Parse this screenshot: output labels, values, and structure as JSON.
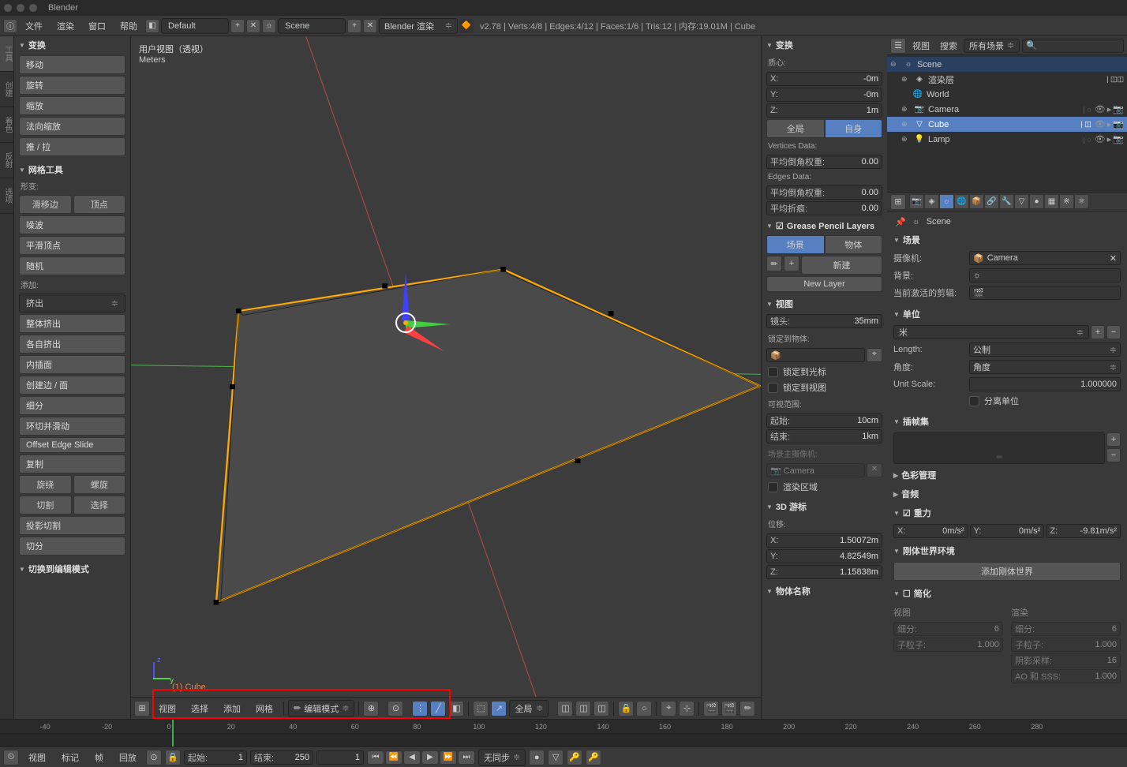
{
  "titlebar": {
    "app": "Blender"
  },
  "topbar": {
    "menus": [
      "文件",
      "渲染",
      "窗口",
      "帮助"
    ],
    "layout": "Default",
    "scene": "Scene",
    "engine": "Blender 渲染",
    "stats": "v2.78 | Verts:4/8 | Edges:4/12 | Faces:1/6 | Tris:12 | 内存:19.01M | Cube"
  },
  "left_tabs": [
    "工具",
    "创建",
    "着色",
    "反射",
    "选项"
  ],
  "tools": {
    "transform_header": "变换",
    "t_move": "移动",
    "t_rot": "旋转",
    "t_scale": "缩放",
    "t_scale_nrm": "法向缩放",
    "t_push": "推 / 拉",
    "mesh_header": "网格工具",
    "deform": "形变:",
    "edge_slide": "滑移边",
    "vertex": "顶点",
    "noise": "噪波",
    "smooth_v": "平滑顶点",
    "random": "随机",
    "add": "添加:",
    "extrude_dd": "挤出",
    "extrude_solid": "整体挤出",
    "extrude_indiv": "各自挤出",
    "inset": "内插面",
    "make_edge": "创建边 / 面",
    "subdiv": "细分",
    "loop_cut": "环切并滑动",
    "offset": "Offset Edge Slide",
    "dup": "复制",
    "spin": "旋绕",
    "spin2": "螺旋",
    "knife": "切割",
    "select": "选择",
    "knife_proj": "投影切割",
    "bisect": "切分",
    "switch_mode": "切换到编辑模式"
  },
  "viewport": {
    "view_label": "用户视图（透视）",
    "unit": "Meters",
    "object": "(1) Cube",
    "footer_menus": [
      "视图",
      "选择",
      "添加",
      "网格"
    ],
    "mode": "编辑模式",
    "orientation": "全局"
  },
  "npanel": {
    "transform_header": "变换",
    "median": "质心:",
    "x": "X:",
    "xv": "-0m",
    "y": "Y:",
    "yv": "-0m",
    "z": "Z:",
    "zv": "1m",
    "global": "全局",
    "local": "自身",
    "vdata": "Vertices Data:",
    "bevel_w": "平均倒角权重:",
    "bevel_wv": "0.00",
    "edata": "Edges Data:",
    "edge_bw": "平均倒角权重:",
    "edge_bwv": "0.00",
    "crease": "平均折痕:",
    "creasev": "0.00",
    "gp": "Grease Pencil Layers",
    "scene": "场景",
    "object": "物体",
    "new": "新建",
    "newlayer": "New Layer",
    "view_header": "视图",
    "lens": "镜头:",
    "lensv": "35mm",
    "locktoobj": "锁定到物体:",
    "lock_cursor": "锁定到光标",
    "lock_view": "锁定到视图",
    "clip": "可视范围:",
    "clip_start": "起始:",
    "clip_startv": "10cm",
    "clip_end": "结束:",
    "clip_endv": "1km",
    "local_cam": "场景主摄像机:",
    "cam_name": "Camera",
    "render_region": "渲染区域",
    "cursor_header": "3D 游标",
    "loc": "位移:",
    "cx": "X:",
    "cxv": "1.50072m",
    "cy": "Y:",
    "cyv": "4.82549m",
    "cz": "Z:",
    "czv": "1.15838m",
    "item_header": "物体名称"
  },
  "outliner": {
    "view_menu": "视图",
    "search_menu": "搜索",
    "filter": "所有场景",
    "scene": "Scene",
    "render_layers": "渲染层",
    "world": "World",
    "camera": "Camera",
    "cube": "Cube",
    "lamp": "Lamp"
  },
  "props": {
    "crumb": "Scene",
    "scene_panel": "场景",
    "camera_lbl": "摄像机:",
    "camera_val": "Camera",
    "bg_lbl": "背景:",
    "clip_lbl": "当前激活的剪辑:",
    "unit_panel": "单位",
    "unit_preset": "米",
    "length_lbl": "Length:",
    "length_val": "公制",
    "angle_lbl": "角度:",
    "angle_val": "角度",
    "scale_lbl": "Unit Scale:",
    "scale_val": "1.000000",
    "separate": "分离单位",
    "keyset_panel": "插帧集",
    "color_panel": "色彩管理",
    "audio_panel": "音频",
    "gravity_panel": "重力",
    "gx": "X:",
    "gxv": "0m/s²",
    "gy": "Y:",
    "gyv": "0m/s²",
    "gz": "Z:",
    "gzv": "-9.81m/s²",
    "rigid_panel": "刚体世界环境",
    "rigid_add": "添加刚体世界",
    "simplify_panel": "简化",
    "sub_view": "视图",
    "sub_render": "渲染",
    "subdiv_lbl": "细分:",
    "subdiv_v": "6",
    "child_lbl": "子粒子:",
    "child_v": "1.000",
    "shadow_lbl": "阴影采样:",
    "shadow_v": "16",
    "ao_lbl": "AO 和 SSS:",
    "ao_v": "1.000"
  },
  "timeline": {
    "ticks": [
      "-40",
      "-20",
      "0",
      "20",
      "40",
      "60",
      "80",
      "100",
      "120",
      "140",
      "160",
      "180",
      "200",
      "220",
      "240",
      "260",
      "280"
    ],
    "footer_menus": [
      "视图",
      "标记",
      "帧",
      "回放"
    ],
    "start_lbl": "起始:",
    "start_v": "1",
    "end_lbl": "结束:",
    "end_v": "250",
    "cur_v": "1",
    "sync": "无同步"
  }
}
